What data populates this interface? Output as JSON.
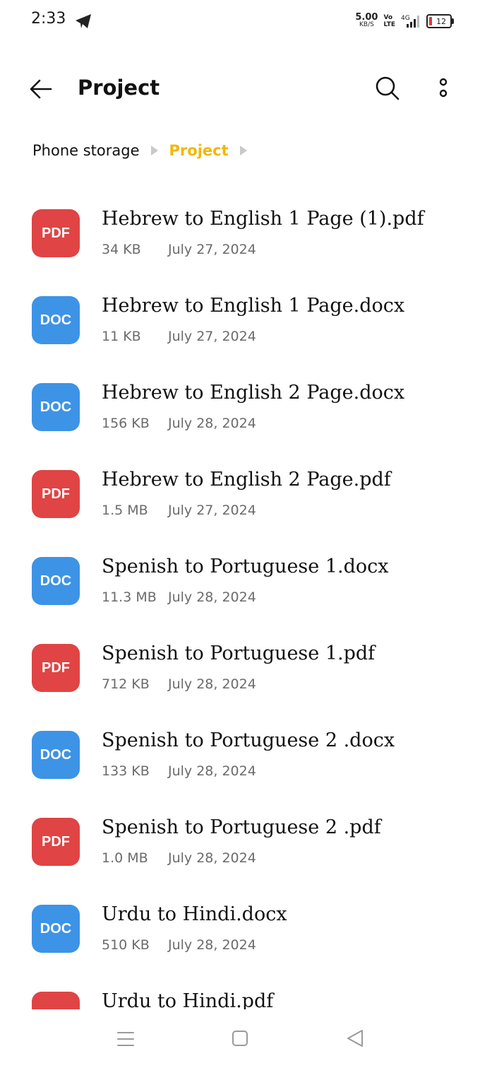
{
  "status_bar": {
    "time": "2:33",
    "net_speed_value": "5.00",
    "net_speed_unit": "KB/S",
    "volte_top": "Vo",
    "volte_bottom": "LTE",
    "network": "4G",
    "battery": "12",
    "battery_color": "#d93b3b"
  },
  "header": {
    "title": "Project"
  },
  "breadcrumb": {
    "root": "Phone storage",
    "current": "Project",
    "active_color": "#f2b705"
  },
  "files": [
    {
      "type": "PDF",
      "name": "Hebrew to English 1 Page (1).pdf",
      "size": "34 KB",
      "date": "July 27, 2024"
    },
    {
      "type": "DOC",
      "name": "Hebrew to English 1 Page.docx",
      "size": "11 KB",
      "date": "July 27, 2024"
    },
    {
      "type": "DOC",
      "name": "Hebrew to English 2 Page.docx",
      "size": "156 KB",
      "date": "July 28, 2024"
    },
    {
      "type": "PDF",
      "name": "Hebrew to English 2 Page.pdf",
      "size": "1.5 MB",
      "date": "July 27, 2024"
    },
    {
      "type": "DOC",
      "name": "Spenish to Portuguese 1.docx",
      "size": "11.3 MB",
      "date": "July 28, 2024"
    },
    {
      "type": "PDF",
      "name": "Spenish to Portuguese 1.pdf",
      "size": "712 KB",
      "date": "July 28, 2024"
    },
    {
      "type": "DOC",
      "name": "Spenish to Portuguese 2 .docx",
      "size": "133 KB",
      "date": "July 28, 2024"
    },
    {
      "type": "PDF",
      "name": "Spenish to Portuguese 2 .pdf",
      "size": "1.0 MB",
      "date": "July 28, 2024"
    },
    {
      "type": "DOC",
      "name": "Urdu to Hindi.docx",
      "size": "510 KB",
      "date": "July 28, 2024"
    },
    {
      "type": "PDF",
      "name": "Urdu to Hindi.pdf",
      "size": "",
      "date": ""
    }
  ],
  "colors": {
    "pdf_badge": "#e04444",
    "doc_badge": "#3d93e6"
  },
  "icons": [
    "telegram-icon",
    "back-arrow-icon",
    "search-icon",
    "more-vertical-icon",
    "nav-menu-icon",
    "nav-home-icon",
    "nav-back-icon"
  ]
}
